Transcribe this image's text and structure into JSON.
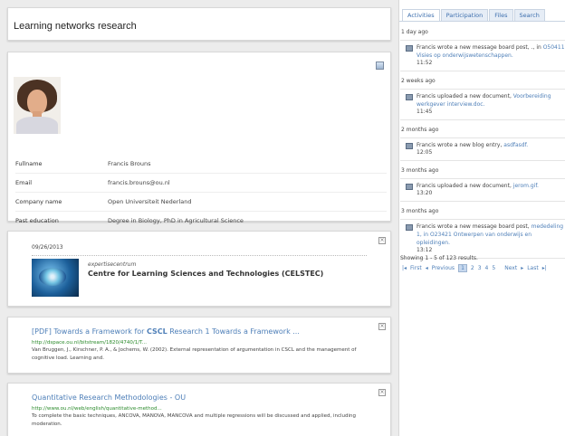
{
  "title": "Learning networks research",
  "profile": {
    "fields": [
      {
        "label": "Fullname",
        "value": "Francis Brouns"
      },
      {
        "label": "Email",
        "value": "francis.brouns@ou.nl"
      },
      {
        "label": "Company name",
        "value": "Open Universiteit Nederland"
      },
      {
        "label": "Past education",
        "value": "Degree in Biology, PhD in Agricultural Science"
      }
    ]
  },
  "card": {
    "date": "09/26/2013",
    "kicker": "expertisecentrum",
    "org": "Centre for Learning Sciences and Technologies (CELSTEC)",
    "close": "×"
  },
  "results": [
    {
      "prefix": "[PDF] Towards a Framework for ",
      "bold": "CSCL",
      "suffix": " Research 1 Towards a Framework ...",
      "url": "http://dspace.ou.nl/bitstream/1820/4740/1/T...",
      "desc": "Van Bruggen, J., Kirschner, P. A., & Jochems, W. (2002). External representation of argumentation in CSCL and the management of cognitive load. Learning and.",
      "close": "×"
    },
    {
      "prefix": "Quantitative Research Methodologies - OU",
      "bold": "",
      "suffix": "",
      "url": "http://www.ou.nl/web/english/quantitative-method...",
      "desc": "To complete the basic techniques, ANCOVA, MANOVA, MANCOVA and multiple regressions will be discussed and applied, including moderation.",
      "close": "×"
    }
  ],
  "tabs": [
    "Activities",
    "Participation",
    "Files",
    "Search"
  ],
  "feed": [
    {
      "heading": "1 day ago",
      "text": "Francis wrote a new message board post, ., in ",
      "link": "O50411 Visies op onderwijswetenschappen.",
      "time": "11:52"
    },
    {
      "heading": "2 weeks ago",
      "text": "Francis uploaded a new document, ",
      "link": "Voorbereiding werkgever interview.doc.",
      "time": "11:45"
    },
    {
      "heading": "2 months ago",
      "text": "Francis wrote a new blog entry, ",
      "link": "asdfasdf.",
      "time": "12:05"
    },
    {
      "heading": "3 months ago",
      "text": "Francis uploaded a new document, ",
      "link": "jerom.gif.",
      "time": "13:20"
    },
    {
      "heading": "3 months ago",
      "text": "Francis wrote a new message board post, ",
      "link": "mededeling 1, in O23421 Ontwerpen van onderwijs en opleidingen.",
      "time": "13:12"
    }
  ],
  "showing": "Showing 1 - 5 of 123 results.",
  "pager": {
    "first": "First",
    "prev": "Previous",
    "pages": [
      "1",
      "2",
      "3",
      "4",
      "5"
    ],
    "next": "Next",
    "last": "Last"
  }
}
